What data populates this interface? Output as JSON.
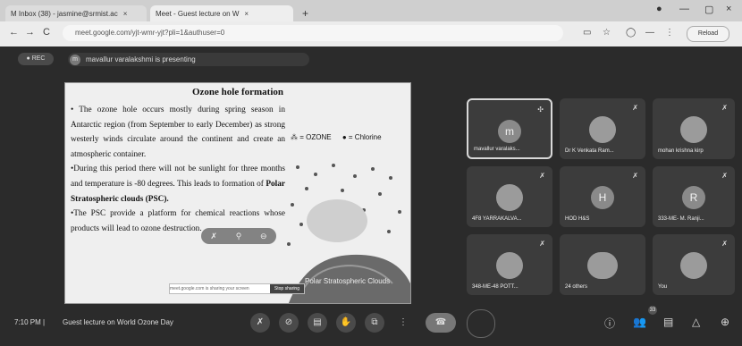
{
  "browser": {
    "tabs": [
      {
        "title": "M  Inbox (38) - jasmine@srmist.ac",
        "close": "×"
      },
      {
        "title": "Meet - Guest lecture on W",
        "close": "×"
      }
    ],
    "new_tab": "+",
    "window_controls": [
      "●",
      "—",
      "▢",
      "×"
    ],
    "nav": [
      "←",
      "→",
      "C"
    ],
    "url": "meet.google.com/yjt-wmr-yjt?pli=1&authuser=0",
    "reload_label": "Reload"
  },
  "meet": {
    "rec_label": "REC",
    "presenter_avatar": "m",
    "presenter_text": "mavallur varalakshmi is presenting",
    "slide": {
      "title": "Ozone hole formation",
      "bullets": [
        {
          "text": "• The ozone hole occurs mostly during spring season in Antarctic region (from September to early December) as strong westerly winds circulate around the continent and create an atmospheric container.",
          "bold": ""
        },
        {
          "text": "•During this period there will not be sunlight for three months and temperature is -80 degrees. This leads to formation of ",
          "bold": "Polar Stratospheric clouds (PSC)."
        },
        {
          "text": "•The PSC provide a platform for chemical reactions whose products will lead to ozone destruction.",
          "bold": ""
        }
      ],
      "legend_ozone": "= OZONE",
      "legend_chlorine": "= Chlorine",
      "art_caption": "Polar Stratospheric Clouds"
    },
    "tooltip_text": "meet.google.com is sharing your screen",
    "tooltip_button": "Stop sharing",
    "tiles": [
      {
        "name": "mavallur varalaks...",
        "avatar": "m",
        "kind": "letter",
        "highlight": true
      },
      {
        "name": "Dr K Venkata Ram...",
        "avatar": "",
        "kind": "photo",
        "highlight": false
      },
      {
        "name": "mohan krishna kirp",
        "avatar": "",
        "kind": "photo",
        "highlight": false
      },
      {
        "name": "4F8 YARRAKALVA...",
        "avatar": "",
        "kind": "photo",
        "highlight": false
      },
      {
        "name": "HOD H&S",
        "avatar": "H",
        "kind": "letter",
        "highlight": false
      },
      {
        "name": "333-ME- M. Ranji...",
        "avatar": "R",
        "kind": "letter",
        "highlight": false
      },
      {
        "name": "348-ME-48 POTT...",
        "avatar": "",
        "kind": "photo",
        "highlight": false
      },
      {
        "name": "24 others",
        "avatar": "",
        "kind": "others",
        "highlight": false
      },
      {
        "name": "You",
        "avatar": "",
        "kind": "photo",
        "highlight": false
      }
    ],
    "mute_glyph": "✗",
    "bottom": {
      "time": "7:10 PM",
      "divider": "|",
      "meeting_title": "Guest lecture on World Ozone Day",
      "participant_count": "33"
    }
  },
  "colors": {
    "meet_bg": "#2b2b2b",
    "tile_bg": "#3c3c3c",
    "end_call": "#777777"
  }
}
